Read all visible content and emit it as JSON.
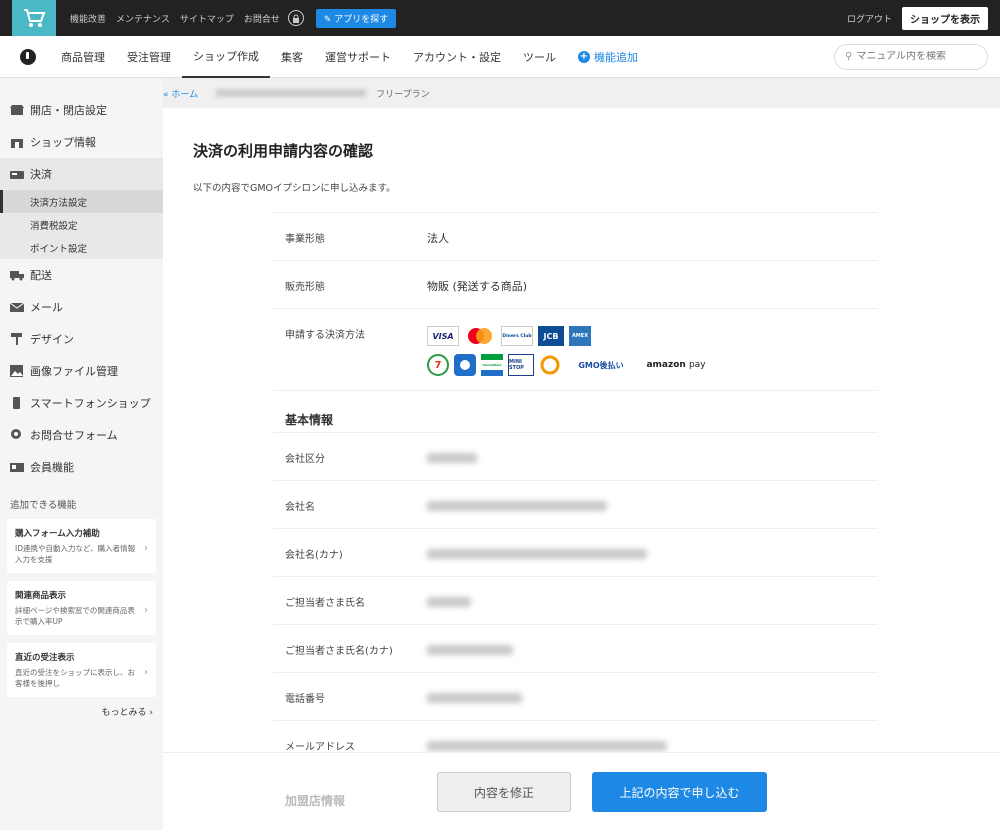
{
  "topbar": {
    "links": [
      "機能改善",
      "メンテナンス",
      "サイトマップ",
      "お問合せ"
    ],
    "app_button": "アプリを探す",
    "logout": "ログアウト",
    "shop_button": "ショップを表示"
  },
  "nav": {
    "items": [
      "商品管理",
      "受注管理",
      "ショップ作成",
      "集客",
      "運営サポート",
      "アカウント・設定",
      "ツール"
    ],
    "add_label": "機能追加",
    "search_placeholder": "マニュアル内を検索"
  },
  "sidebar": {
    "items": [
      "開店・閉店設定",
      "ショップ情報",
      "決済",
      "配送",
      "メール",
      "デザイン",
      "画像ファイル管理",
      "スマートフォンショップ",
      "お問合せフォーム",
      "会員機能"
    ],
    "sub_items": [
      "決済方法設定",
      "消費税設定",
      "ポイント設定"
    ],
    "extra_title": "追加できる機能",
    "cards": [
      {
        "title": "購入フォーム入力補助",
        "desc": "ID連携や自動入力など、購入者情報入力を支援"
      },
      {
        "title": "関連商品表示",
        "desc": "詳細ページや検索窓での関連商品表示で購入率UP"
      },
      {
        "title": "直近の受注表示",
        "desc": "直近の受注をショップに表示し、お客様を後押し"
      }
    ],
    "more": "もっとみる"
  },
  "breadcrumb": {
    "home": "« ホーム",
    "plan": "フリープラン"
  },
  "main": {
    "title": "決済の利用申請内容の確認",
    "desc": "以下の内容でGMOイプシロンに申し込みます。",
    "fields": [
      {
        "label": "事業形態",
        "value": "法人"
      },
      {
        "label": "販売形態",
        "value": "物販 (発送する商品)"
      },
      {
        "label": "申請する決済方法",
        "value": ""
      }
    ],
    "section_basic": "基本情報",
    "basic_labels": [
      "会社区分",
      "会社名",
      "会社名(カナ)",
      "ご担当者さま氏名",
      "ご担当者さま氏名(カナ)",
      "電話番号",
      "メールアドレス"
    ],
    "section_merchant": "加盟店情報",
    "payment_logos": {
      "visa": "VISA",
      "diners": "Diners Club",
      "jcb": "JCB",
      "amex": "AMEX",
      "seven": "7",
      "famima": "FamilyMart",
      "ministop": "MINI STOP",
      "gmo": "GMO後払い",
      "amazon_1": "amazon",
      "amazon_2": "pay"
    },
    "edit_button": "内容を修正",
    "submit_button": "上記の内容で申し込む"
  }
}
